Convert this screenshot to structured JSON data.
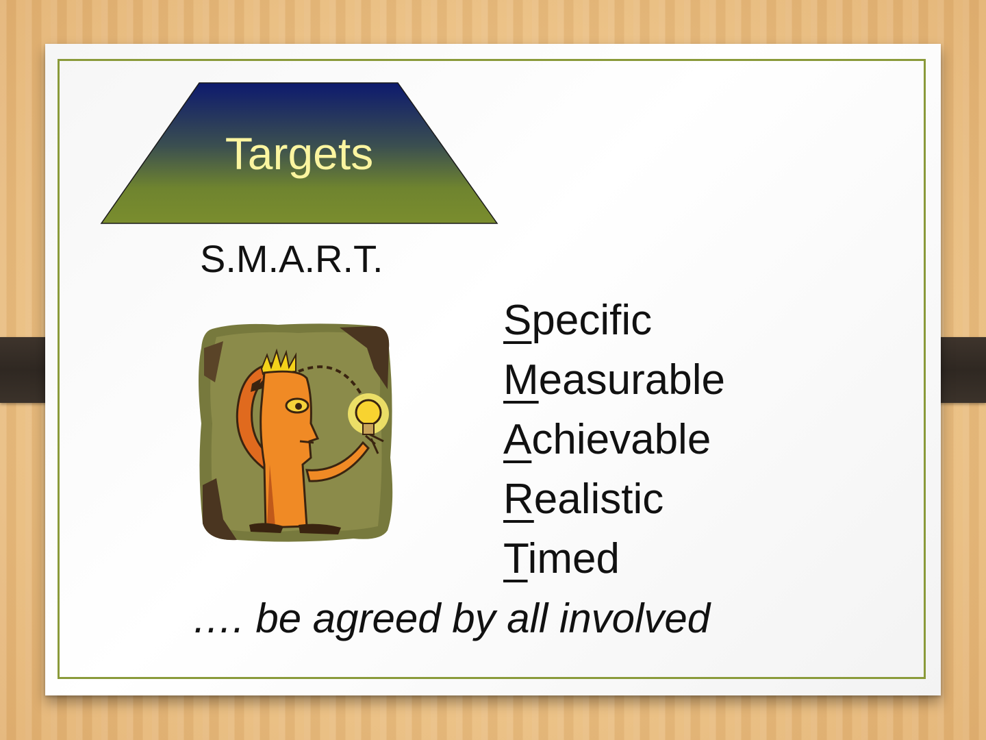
{
  "slide": {
    "banner_title": "Targets",
    "subtitle": "S.M.A.R.T.",
    "acronym": [
      {
        "initial": "S",
        "rest": "pecific"
      },
      {
        "initial": "M",
        "rest": "easurable"
      },
      {
        "initial": "A",
        "rest": "chievable"
      },
      {
        "initial": "R",
        "rest": "ealistic"
      },
      {
        "initial": "T",
        "rest": "imed"
      }
    ],
    "footer_note": "…. be agreed by all involved"
  },
  "colors": {
    "background_wood": "#ebbf82",
    "card": "#ffffff",
    "frame_border": "#8a9a3a",
    "banner_top": "#0d1a6e",
    "banner_bottom": "#7a8d2e",
    "banner_text": "#fbf5a0",
    "clip": "#2f2822"
  },
  "icons": {
    "illustration": "person-with-lightbulb-idea-clipart"
  }
}
